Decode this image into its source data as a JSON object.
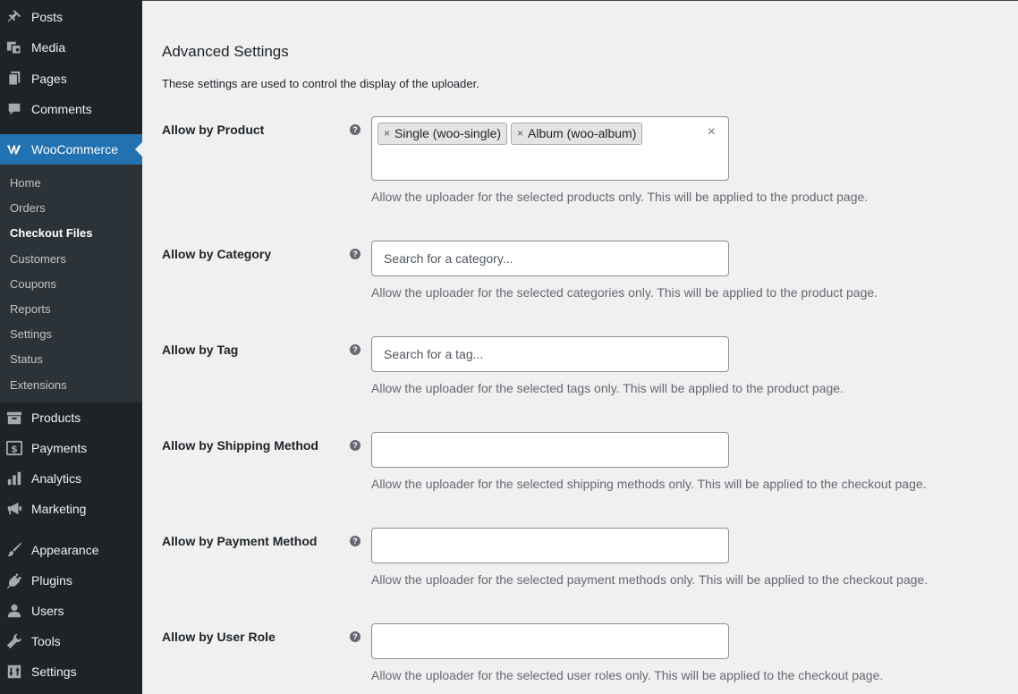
{
  "sidebar": {
    "top_items": [
      {
        "label": "Posts",
        "icon": "pin-icon"
      },
      {
        "label": "Media",
        "icon": "media-icon"
      },
      {
        "label": "Pages",
        "icon": "pages-icon"
      },
      {
        "label": "Comments",
        "icon": "comments-icon"
      }
    ],
    "woocommerce": {
      "label": "WooCommerce",
      "icon": "woocommerce-icon"
    },
    "submenu": [
      {
        "label": "Home"
      },
      {
        "label": "Orders"
      },
      {
        "label": "Checkout Files"
      },
      {
        "label": "Customers"
      },
      {
        "label": "Coupons"
      },
      {
        "label": "Reports"
      },
      {
        "label": "Settings"
      },
      {
        "label": "Status"
      },
      {
        "label": "Extensions"
      }
    ],
    "bottom_items": [
      {
        "label": "Products",
        "icon": "archive-icon"
      },
      {
        "label": "Payments",
        "icon": "payments-icon"
      },
      {
        "label": "Analytics",
        "icon": "bar-chart-icon"
      },
      {
        "label": "Marketing",
        "icon": "megaphone-icon"
      },
      {
        "label": "Appearance",
        "icon": "brush-icon"
      },
      {
        "label": "Plugins",
        "icon": "plugin-icon"
      },
      {
        "label": "Users",
        "icon": "user-icon"
      },
      {
        "label": "Tools",
        "icon": "wrench-icon"
      },
      {
        "label": "Settings",
        "icon": "settings-sliders-icon"
      }
    ],
    "colors": {
      "bg": "#1d2327",
      "active": "#2271b1",
      "submenu_bg": "#2c3338"
    }
  },
  "main": {
    "title": "Advanced Settings",
    "description": "These settings are used to control the display of the uploader.",
    "help_glyph": "?",
    "rows": [
      {
        "label": "Allow by Product",
        "tags": [
          {
            "remove": "×",
            "label": "Single (woo-single)"
          },
          {
            "remove": "×",
            "label": "Album (woo-album)"
          }
        ],
        "clear": "×",
        "description": "Allow the uploader for the selected products only. This will be applied to the product page."
      },
      {
        "label": "Allow by Category",
        "placeholder": "Search for a category...",
        "description": "Allow the uploader for the selected categories only. This will be applied to the product page."
      },
      {
        "label": "Allow by Tag",
        "placeholder": "Search for a tag...",
        "description": "Allow the uploader for the selected tags only. This will be applied to the product page."
      },
      {
        "label": "Allow by Shipping Method",
        "placeholder": "",
        "description": "Allow the uploader for the selected shipping methods only. This will be applied to the checkout page."
      },
      {
        "label": "Allow by Payment Method",
        "placeholder": "",
        "description": "Allow the uploader for the selected payment methods only. This will be applied to the checkout page."
      },
      {
        "label": "Allow by User Role",
        "placeholder": "",
        "description": "Allow the uploader for the selected user roles only. This will be applied to the checkout page."
      }
    ]
  }
}
